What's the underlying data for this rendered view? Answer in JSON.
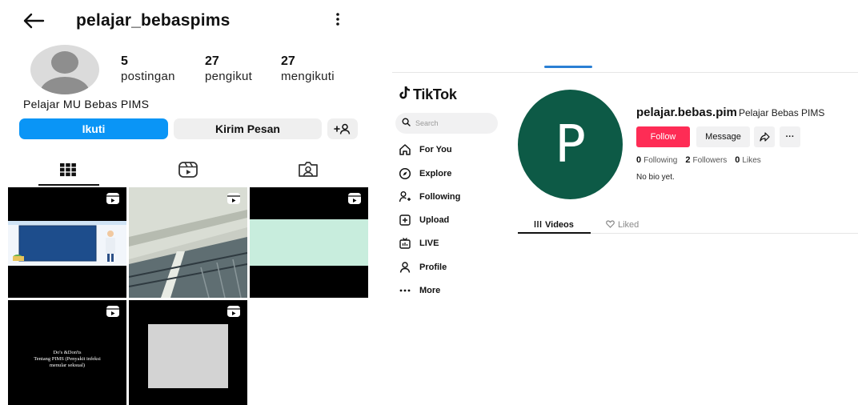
{
  "instagram": {
    "back_icon": "back-arrow-icon",
    "username": "pelajar_bebaspims",
    "menu_icon": "more-vertical-icon",
    "stats": [
      {
        "value": "5",
        "label": "postingan"
      },
      {
        "value": "27",
        "label": "pengikut"
      },
      {
        "value": "27",
        "label": "mengikuti"
      }
    ],
    "bio": "Pelajar MU Bebas PIMS",
    "follow_label": "Ikuti",
    "message_label": "Kirim Pesan",
    "tabs": [
      "grid-icon",
      "reels-icon",
      "tagged-icon"
    ],
    "posts": [
      {
        "type": "reel",
        "thumb": "slide-presentation"
      },
      {
        "type": "reel",
        "thumb": "ceiling-photo"
      },
      {
        "type": "reel",
        "thumb": "mint-banner"
      },
      {
        "type": "reel",
        "thumb": "text-slide",
        "caption_line1": "Do's &Don'ts",
        "caption_line2": "Tentang PIMS (Penyakit infeksi",
        "caption_line3": "menular seksual)"
      },
      {
        "type": "reel",
        "thumb": "grey-square"
      }
    ],
    "colors": {
      "accent": "#0a95f6"
    }
  },
  "tiktok": {
    "logo_text": "TikTok",
    "search_placeholder": "Search",
    "nav": [
      {
        "icon": "home-icon",
        "label": "For You"
      },
      {
        "icon": "compass-icon",
        "label": "Explore"
      },
      {
        "icon": "following-icon",
        "label": "Following"
      },
      {
        "icon": "upload-icon",
        "label": "Upload"
      },
      {
        "icon": "live-icon",
        "label": "LIVE"
      },
      {
        "icon": "profile-icon",
        "label": "Profile"
      },
      {
        "icon": "more-dots-icon",
        "label": "More"
      }
    ],
    "avatar_letter": "P",
    "handle": "pelajar.bebas.pim",
    "nickname": "Pelajar Bebas PIMS",
    "follow_label": "Follow",
    "message_label": "Message",
    "more_label": "···",
    "stats": [
      {
        "value": "0",
        "label": "Following"
      },
      {
        "value": "2",
        "label": "Followers"
      },
      {
        "value": "0",
        "label": "Likes"
      }
    ],
    "bio": "No bio yet.",
    "tabs": [
      {
        "icon": "videos-icon",
        "label": "Videos",
        "active": true
      },
      {
        "icon": "liked-icon",
        "label": "Liked",
        "active": false
      }
    ],
    "colors": {
      "follow": "#fe2c55",
      "avatar_bg": "#0d5a46"
    }
  }
}
